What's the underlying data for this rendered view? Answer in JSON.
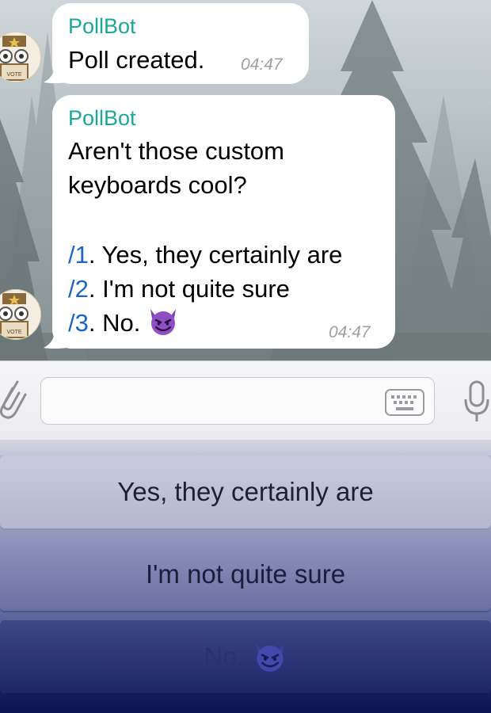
{
  "messages": [
    {
      "sender": "PollBot",
      "text": "Poll created.",
      "time": "04:47"
    },
    {
      "sender": "PollBot",
      "text_lines": [
        "Aren't those custom",
        "keyboards cool?"
      ],
      "options": [
        {
          "command": "/1",
          "text": ". Yes, they certainly are"
        },
        {
          "command": "/2",
          "text": ". I'm not quite sure"
        },
        {
          "command": "/3",
          "text": ". No."
        }
      ],
      "time": "04:47"
    }
  ],
  "avatar": {
    "icon": "ballot-box-robot-icon",
    "label": "VOTE"
  },
  "input": {
    "placeholder": "",
    "value": ""
  },
  "keyboard": {
    "buttons": [
      {
        "label": "Yes, they certainly are"
      },
      {
        "label": "I'm not quite sure"
      },
      {
        "label": "No."
      }
    ]
  },
  "colors": {
    "sender": "#1aa89a",
    "command_link": "#1a66c8",
    "timestamp": "#9aa0a4",
    "devil_emoji": "#7b3fb0"
  },
  "icons": {
    "attach": "paperclip-icon",
    "keyboard_toggle": "keyboard-icon",
    "microphone": "microphone-icon",
    "emoji": "smiling-devil-emoji"
  }
}
